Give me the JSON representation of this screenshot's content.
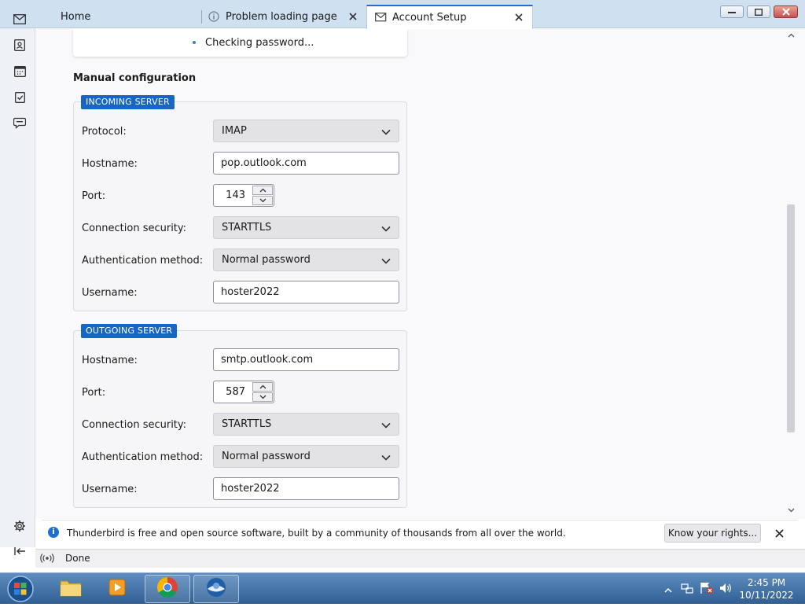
{
  "tabs": [
    {
      "label": "Home"
    },
    {
      "label": "Problem loading page"
    },
    {
      "label": "Account Setup"
    }
  ],
  "status_card": {
    "text": "Checking password..."
  },
  "section_title": "Manual configuration",
  "incoming": {
    "legend": "INCOMING SERVER",
    "protocol_label": "Protocol:",
    "protocol_value": "IMAP",
    "hostname_label": "Hostname:",
    "hostname_value": "pop.outlook.com",
    "port_label": "Port:",
    "port_value": "143",
    "security_label": "Connection security:",
    "security_value": "STARTTLS",
    "auth_label": "Authentication method:",
    "auth_value": "Normal password",
    "username_label": "Username:",
    "username_value": "hoster2022"
  },
  "outgoing": {
    "legend": "OUTGOING SERVER",
    "hostname_label": "Hostname:",
    "hostname_value": "smtp.outlook.com",
    "port_label": "Port:",
    "port_value": "587",
    "security_label": "Connection security:",
    "security_value": "STARTTLS",
    "auth_label": "Authentication method:",
    "auth_value": "Normal password",
    "username_label": "Username:",
    "username_value": "hoster2022"
  },
  "notification": {
    "text": "Thunderbird is free and open source software, built by a community of thousands from all over the world.",
    "button_label": "Know your rights..."
  },
  "statusbar": {
    "text": "Done"
  },
  "clock": {
    "time": "2:45 PM",
    "date": "10/11/2022"
  },
  "colors": {
    "accent": "#1766c6",
    "legend_text": "#ffffff"
  }
}
